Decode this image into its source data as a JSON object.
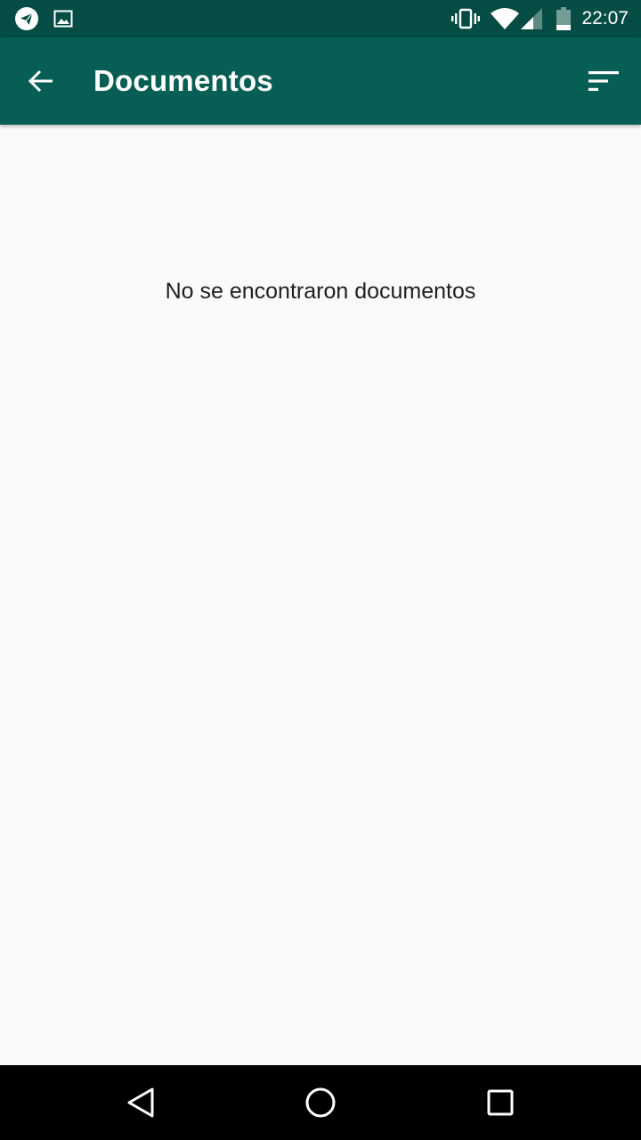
{
  "status_bar": {
    "time": "22:07",
    "left_icons": [
      "telegram-icon",
      "image-icon"
    ],
    "right_icons": [
      "vibrate-icon",
      "wifi-icon",
      "signal-icon",
      "battery-icon"
    ]
  },
  "app_bar": {
    "title": "Documentos",
    "back_icon": "arrow-back-icon",
    "sort_icon": "sort-icon"
  },
  "content": {
    "empty_message": "No se encontraron documentos"
  },
  "nav_bar": {
    "buttons": [
      "back-triangle-icon",
      "home-circle-icon",
      "recents-square-icon"
    ]
  },
  "colors": {
    "status_bar": "#054d44",
    "app_bar": "#075e54",
    "background": "#fafafa",
    "nav_bar": "#000000"
  }
}
